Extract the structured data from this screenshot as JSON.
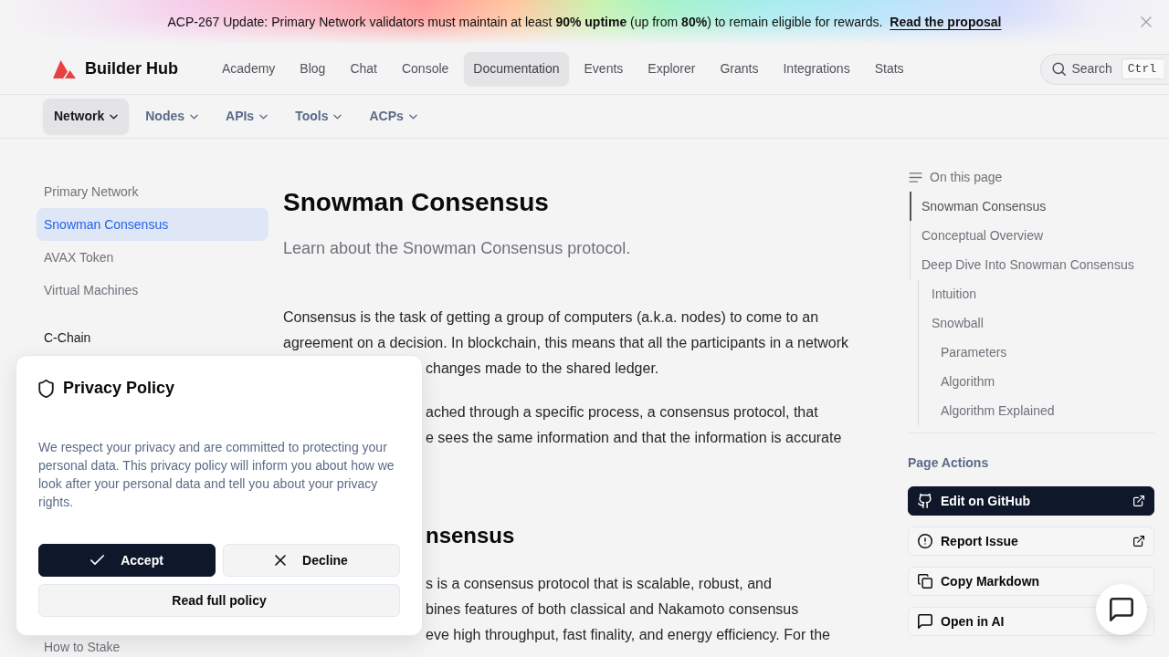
{
  "banner": {
    "text": "ACP-267 Update: Primary Network validators must maintain at least **90% uptime** (up from **80%**) to remain eligible for rewards.",
    "link": "Read the proposal"
  },
  "header": {
    "brand": "Builder Hub",
    "nav": [
      {
        "label": "Academy",
        "selected": false
      },
      {
        "label": "Blog",
        "selected": false
      },
      {
        "label": "Chat",
        "selected": false
      },
      {
        "label": "Console",
        "selected": false
      },
      {
        "label": "Documentation",
        "selected": true
      },
      {
        "label": "Events",
        "selected": false
      },
      {
        "label": "Explorer",
        "selected": false
      },
      {
        "label": "Grants",
        "selected": false
      },
      {
        "label": "Integrations",
        "selected": false
      },
      {
        "label": "Stats",
        "selected": false
      }
    ],
    "search": {
      "label": "Search",
      "shortcut": "Ctrl"
    }
  },
  "subnav": [
    {
      "label": "Network",
      "selected": true
    },
    {
      "label": "Nodes",
      "selected": false
    },
    {
      "label": "APIs",
      "selected": false
    },
    {
      "label": "Tools",
      "selected": false
    },
    {
      "label": "ACPs",
      "selected": false
    }
  ],
  "sidebar": {
    "items": [
      {
        "kind": "link",
        "label": "Primary Network",
        "selected": false
      },
      {
        "kind": "link",
        "label": "Snowman Consensus",
        "selected": true
      },
      {
        "kind": "link",
        "label": "AVAX Token",
        "selected": false
      },
      {
        "kind": "link",
        "label": "Virtual Machines",
        "selected": false
      },
      {
        "kind": "heading",
        "label": "C-Chain",
        "selected": false
      },
      {
        "kind": "link",
        "label": "How to Stake",
        "selected": false
      }
    ]
  },
  "article": {
    "title": "Snowman Consensus",
    "subtitle": "Learn about the Snowman Consensus protocol.",
    "blocks": [
      {
        "kind": "paragraph",
        "lines": [
          {
            "text": "Consensus is the task of getting a group of computers (a.k.a. nodes) to come to an",
            "cut": false
          },
          {
            "text": "agreement on a decision. In blockchain, this means that all the participants in a network",
            "cut": false
          },
          {
            "text": "changes made to the shared ledger.",
            "cut": true
          }
        ]
      },
      {
        "kind": "paragraph",
        "lines": [
          {
            "text": "ached through a specific process, a consensus protocol, that",
            "cut": true
          },
          {
            "text": "e sees the same information and that the information is accurate",
            "cut": true
          }
        ]
      },
      {
        "kind": "heading",
        "text": "nsensus",
        "cut": true
      },
      {
        "kind": "paragraph",
        "lines": [
          {
            "text": "s is a consensus protocol that is scalable, robust, and",
            "cut": true
          },
          {
            "text": "bines features of both classical and Nakamoto consensus",
            "cut": true
          },
          {
            "text": "eve high throughput, fast finality, and energy efficiency. For the",
            "cut": true
          }
        ]
      }
    ]
  },
  "toc": {
    "title": "On this page",
    "items": [
      {
        "label": "Snowman Consensus",
        "selected": true
      },
      {
        "label": "Conceptual Overview",
        "selected": false
      },
      {
        "label": "Deep Dive Into Snowman Consensus",
        "selected": false,
        "children": [
          {
            "label": "Intuition",
            "selected": false
          },
          {
            "label": "Snowball",
            "selected": false,
            "children": [
              {
                "label": "Parameters",
                "selected": false
              },
              {
                "label": "Algorithm",
                "selected": false
              },
              {
                "label": "Algorithm Explained",
                "selected": false
              }
            ]
          }
        ]
      }
    ]
  },
  "page_actions": {
    "title": "Page Actions",
    "buttons": [
      {
        "label": "Edit on GitHub",
        "kind": "primary",
        "external": true
      },
      {
        "label": "Report Issue",
        "kind": "secondary",
        "external": true
      },
      {
        "label": "Copy Markdown",
        "kind": "secondary",
        "external": false
      },
      {
        "label": "Open in AI",
        "kind": "secondary",
        "external": false
      }
    ]
  },
  "privacy_dialog": {
    "title": "Privacy Policy",
    "text": "We respect your privacy and are committed to protecting your personal data. This privacy policy will inform you about how we look after your personal data and tell you about your privacy rights.",
    "buttons": [
      {
        "label": "Accept",
        "kind": "primary"
      },
      {
        "label": "Decline",
        "kind": "secondary"
      },
      {
        "label": "Read full policy",
        "kind": "wide"
      }
    ]
  }
}
